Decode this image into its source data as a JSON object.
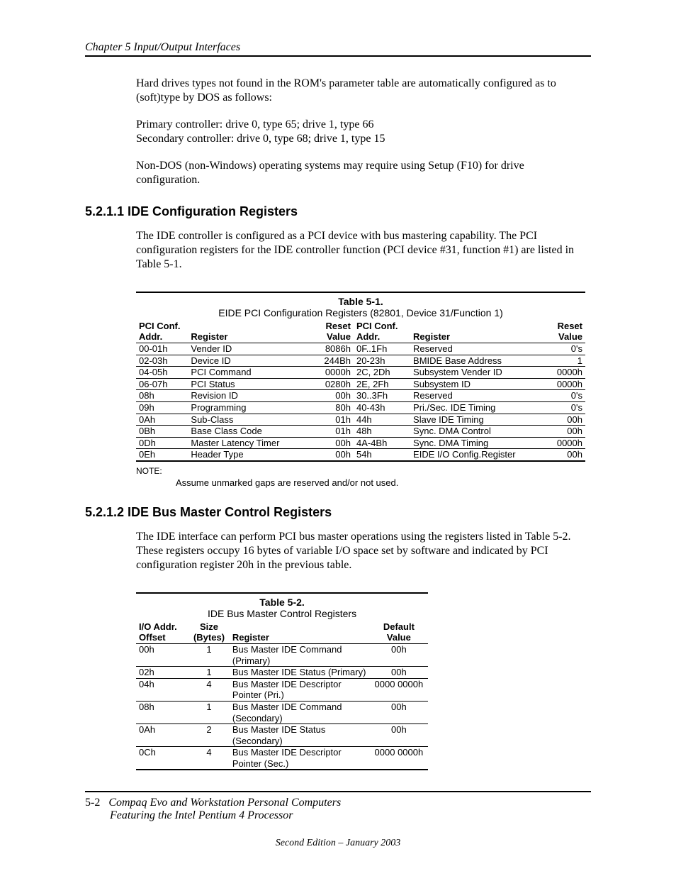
{
  "header": {
    "chapter": "Chapter 5  Input/Output Interfaces"
  },
  "intro": {
    "p1": "Hard drives types not found in the ROM's parameter table are automatically configured as to (soft)type by DOS as follows:",
    "p2a": "Primary controller: drive 0, type 65;  drive 1, type 66",
    "p2b": "Secondary controller: drive 0, type 68; drive 1, type 15",
    "p3": "Non-DOS (non-Windows) operating systems may require using Setup (F10) for drive configuration."
  },
  "section1": {
    "heading": "5.2.1.1   IDE Configuration Registers",
    "para": "The IDE controller is configured as a PCI device with bus mastering capability. The PCI configuration registers for the IDE controller function (PCI device #31, function #1) are listed in Table 5-1."
  },
  "table1": {
    "title": "Table 5-1.",
    "subtitle": "EIDE PCI Configuration Registers (82801, Device 31/Function 1)",
    "head_addr": "PCI Conf. Addr.",
    "head_reg": "Register",
    "head_reset": "Reset Value",
    "rows": [
      {
        "a1": "00-01h",
        "r1": "Vender ID",
        "v1": "8086h",
        "a2": "0F..1Fh",
        "r2": "Reserved",
        "v2": "0's"
      },
      {
        "a1": "02-03h",
        "r1": "Device ID",
        "v1": "244Bh",
        "a2": "20-23h",
        "r2": "BMIDE Base Address",
        "v2": "1"
      },
      {
        "a1": "04-05h",
        "r1": "PCI Command",
        "v1": "0000h",
        "a2": "2C, 2Dh",
        "r2": "Subsystem Vender ID",
        "v2": "0000h"
      },
      {
        "a1": "06-07h",
        "r1": "PCI Status",
        "v1": "0280h",
        "a2": "2E, 2Fh",
        "r2": "Subsystem ID",
        "v2": "0000h"
      },
      {
        "a1": "08h",
        "r1": "Revision ID",
        "v1": "00h",
        "a2": "30..3Fh",
        "r2": "Reserved",
        "v2": "0's"
      },
      {
        "a1": "09h",
        "r1": "Programming",
        "v1": "80h",
        "a2": "40-43h",
        "r2": "Pri./Sec. IDE Timing",
        "v2": "0's"
      },
      {
        "a1": "0Ah",
        "r1": "Sub-Class",
        "v1": "01h",
        "a2": "44h",
        "r2": "Slave IDE Timing",
        "v2": "00h"
      },
      {
        "a1": "0Bh",
        "r1": "Base Class Code",
        "v1": "01h",
        "a2": "48h",
        "r2": "Sync. DMA Control",
        "v2": "00h"
      },
      {
        "a1": "0Dh",
        "r1": "Master Latency Timer",
        "v1": "00h",
        "a2": "4A-4Bh",
        "r2": "Sync. DMA Timing",
        "v2": "0000h"
      },
      {
        "a1": "0Eh",
        "r1": "Header Type",
        "v1": "00h",
        "a2": "54h",
        "r2": "EIDE I/O Config.Register",
        "v2": "00h"
      }
    ],
    "note_label": "NOTE:",
    "note_body": "Assume unmarked gaps are reserved and/or not used."
  },
  "section2": {
    "heading": "5.2.1.2   IDE Bus Master Control Registers",
    "para": "The IDE interface can perform PCI bus master operations using the registers listed in Table 5-2. These registers occupy 16 bytes of variable I/O space set by software and indicated by PCI configuration register 20h in the previous table."
  },
  "table2": {
    "title": "Table 5-2.",
    "subtitle": "IDE Bus Master Control Registers",
    "head_offset": "I/O Addr. Offset",
    "head_size": "Size (Bytes)",
    "head_reg": "Register",
    "head_default": "Default Value",
    "rows": [
      {
        "o": "00h",
        "s": "1",
        "r": "Bus Master IDE Command (Primary)",
        "d": "00h"
      },
      {
        "o": "02h",
        "s": "1",
        "r": "Bus Master IDE Status (Primary)",
        "d": "00h"
      },
      {
        "o": "04h",
        "s": "4",
        "r": "Bus Master IDE Descriptor Pointer (Pri.)",
        "d": "0000 0000h"
      },
      {
        "o": "08h",
        "s": "1",
        "r": "Bus Master IDE Command (Secondary)",
        "d": "00h"
      },
      {
        "o": "0Ah",
        "s": "2",
        "r": "Bus Master IDE Status (Secondary)",
        "d": "00h"
      },
      {
        "o": "0Ch",
        "s": "4",
        "r": "Bus Master IDE Descriptor Pointer (Sec.)",
        "d": "0000 0000h"
      }
    ]
  },
  "footer": {
    "page": "5-2",
    "line1": "Compaq Evo and Workstation Personal Computers",
    "line2": "Featuring the Intel Pentium 4 Processor",
    "edition": "Second Edition – January 2003"
  }
}
